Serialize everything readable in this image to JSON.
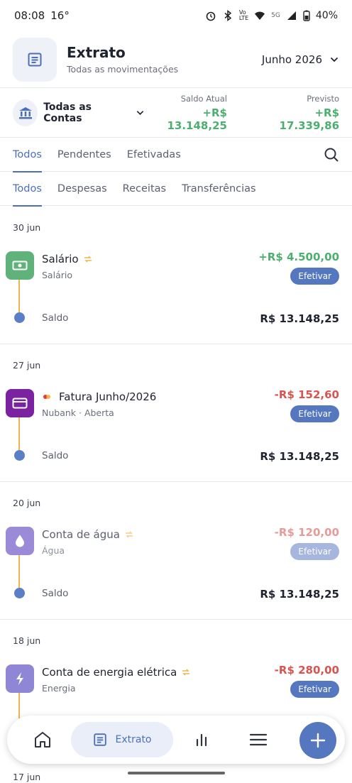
{
  "status": {
    "time": "08:08",
    "temp": "16°",
    "battery": "40%"
  },
  "header": {
    "title": "Extrato",
    "subtitle": "Todas as movimentações",
    "month": "Junho 2026"
  },
  "accounts": {
    "name": "Todas as Contas",
    "saldo_atual_label": "Saldo Atual",
    "saldo_atual": "+R$ 13.148,25",
    "previsto_label": "Previsto",
    "previsto": "+R$ 17.339,86"
  },
  "tabs_status": [
    "Todos",
    "Pendentes",
    "Efetivadas"
  ],
  "tabs_type": [
    "Todos",
    "Despesas",
    "Receitas",
    "Transferências"
  ],
  "groups": [
    {
      "date": "30 jun",
      "title": "Salário",
      "sub": "Salário",
      "amount": "+R$ 4.500,00",
      "button": "Efetivar",
      "saldo_label": "Saldo",
      "saldo": "R$ 13.148,25"
    },
    {
      "date": "27 jun",
      "title": "Fatura Junho/2026",
      "sub": "Nubank · Aberta",
      "amount": "-R$ 152,60",
      "button": "Efetivar",
      "saldo_label": "Saldo",
      "saldo": "R$ 13.148,25"
    },
    {
      "date": "20 jun",
      "title": "Conta de água",
      "sub": "Água",
      "amount": "-R$ 120,00",
      "button": "Efetivar",
      "saldo_label": "Saldo",
      "saldo": "R$ 13.148,25"
    },
    {
      "date": "18 jun",
      "title": "Conta de energia elétrica",
      "sub": "Energia",
      "amount": "-R$ 280,00",
      "button": "Efetivar"
    }
  ],
  "next_date": "17 jun",
  "nav": {
    "active_label": "Extrato"
  },
  "colors": {
    "accent": "#5577c0",
    "income": "#4caf6e",
    "expense": "#d9534f",
    "timeline": "#f0b547"
  }
}
